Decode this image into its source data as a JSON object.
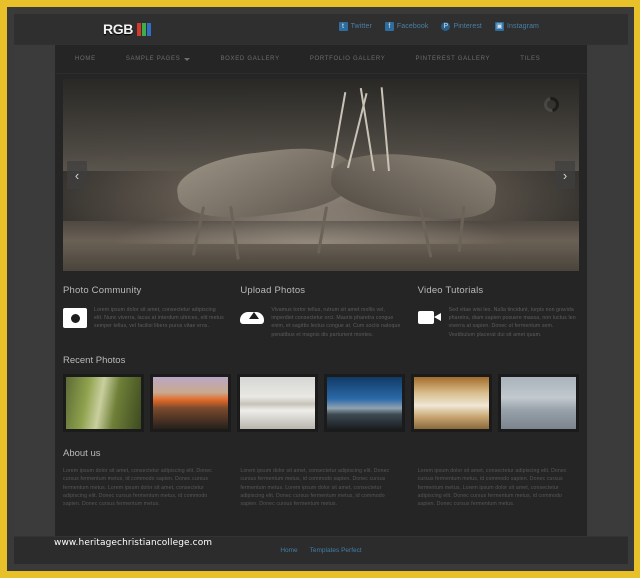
{
  "brand": {
    "name": "RGB",
    "bar_colors": [
      "#d33a2c",
      "#3fae49",
      "#2f6fc4"
    ]
  },
  "social": [
    {
      "name": "Twitter",
      "icon": "twitter-icon",
      "glyph": "t"
    },
    {
      "name": "Facebook",
      "icon": "facebook-icon",
      "glyph": "f"
    },
    {
      "name": "Pinterest",
      "icon": "pinterest-icon",
      "glyph": "P"
    },
    {
      "name": "Instagram",
      "icon": "instagram-icon",
      "glyph": "▣"
    }
  ],
  "nav": [
    {
      "label": "HOME",
      "has_caret": false
    },
    {
      "label": "SAMPLE PAGES",
      "has_caret": true
    },
    {
      "label": "BOXED GALLERY",
      "has_caret": false
    },
    {
      "label": "PORTFOLIO GALLERY",
      "has_caret": false
    },
    {
      "label": "PINTEREST GALLERY",
      "has_caret": false
    },
    {
      "label": "TILES",
      "has_caret": false
    }
  ],
  "hero": {
    "alt": "Two oryx antelopes fighting in dust, black and white photo",
    "prev_label": "‹",
    "next_label": "›",
    "spinner": "loading-spinner"
  },
  "features": [
    {
      "title": "Photo Community",
      "icon": "camera-icon",
      "text": "Lorem ipsum dolor sit amet, consectetur adipiscing elit. Nunc viverra, lacus at interdum ultrices, elit metus semper tellus, vel facilisi libero purus vitae eros."
    },
    {
      "title": "Upload Photos",
      "icon": "cloud-upload-icon",
      "text": "Vivamus tortor tellus, rutrum sit amet mollis vel, imperdiet consectetur orci. Mauris pharetra congue enim, et sagittis lectus congue at. Cum sociis natoque penatibus et magnis dis parturient montes."
    },
    {
      "title": "Video Tutorials",
      "icon": "video-camera-icon",
      "text": "Sed vitae wisi leo. Nulla tincidunt, turpis non gravida pharetra, diam sapien posuere massa, non luctus leo viverra at sapien. Donec ut fermentum sem. Vestibulum placerat dui sit amet quam."
    }
  ],
  "recent_photos": {
    "title": "Recent Photos",
    "items": [
      {
        "caption": "Aspen forest",
        "class": "t1"
      },
      {
        "caption": "Sunset mountain",
        "class": "t2"
      },
      {
        "caption": "Snowy lake",
        "class": "t3"
      },
      {
        "caption": "Blue sky lake",
        "class": "t4"
      },
      {
        "caption": "Golden field",
        "class": "t5"
      },
      {
        "caption": "Winter trees",
        "class": "t6"
      }
    ]
  },
  "about": {
    "title": "About us",
    "columns": [
      "Lorem ipsum dolor sit amet, consectetur adipiscing elit. Donec cursus fermentum metus, id commodo sapien. Donec cursus fermentum metus. Lorem ipsum dolor sit amet, consectetur adipiscing elit. Donec cursus fermentum metus, id commodo sapien. Donec cursus fermentum metus.",
      "Lorem ipsum dolor sit amet, consectetur adipiscing elit. Donec cursus fermentum metus, id commodo sapien. Donec cursus fermentum metus. Lorem ipsum dolor sit amet, consectetur adipiscing elit. Donec cursus fermentum metus, id commodo sapien. Donec cursus fermentum metus.",
      "Lorem ipsum dolor sit amet, consectetur adipiscing elit. Donec cursus fermentum metus, id commodo sapien. Donec cursus fermentum metus. Lorem ipsum dolor sit amet, consectetur adipiscing elit. Donec cursus fermentum metus, id commodo sapien. Donec cursus fermentum metus."
    ]
  },
  "watermark": "www.heritagechristiancollege.com",
  "footer": [
    {
      "label": "Home"
    },
    {
      "label": "Templates Perfect"
    }
  ],
  "colors": {
    "frame": "#e8c12a",
    "page_bg": "#3b3b3b",
    "content_bg": "#252525",
    "link": "#3f7ea8"
  }
}
